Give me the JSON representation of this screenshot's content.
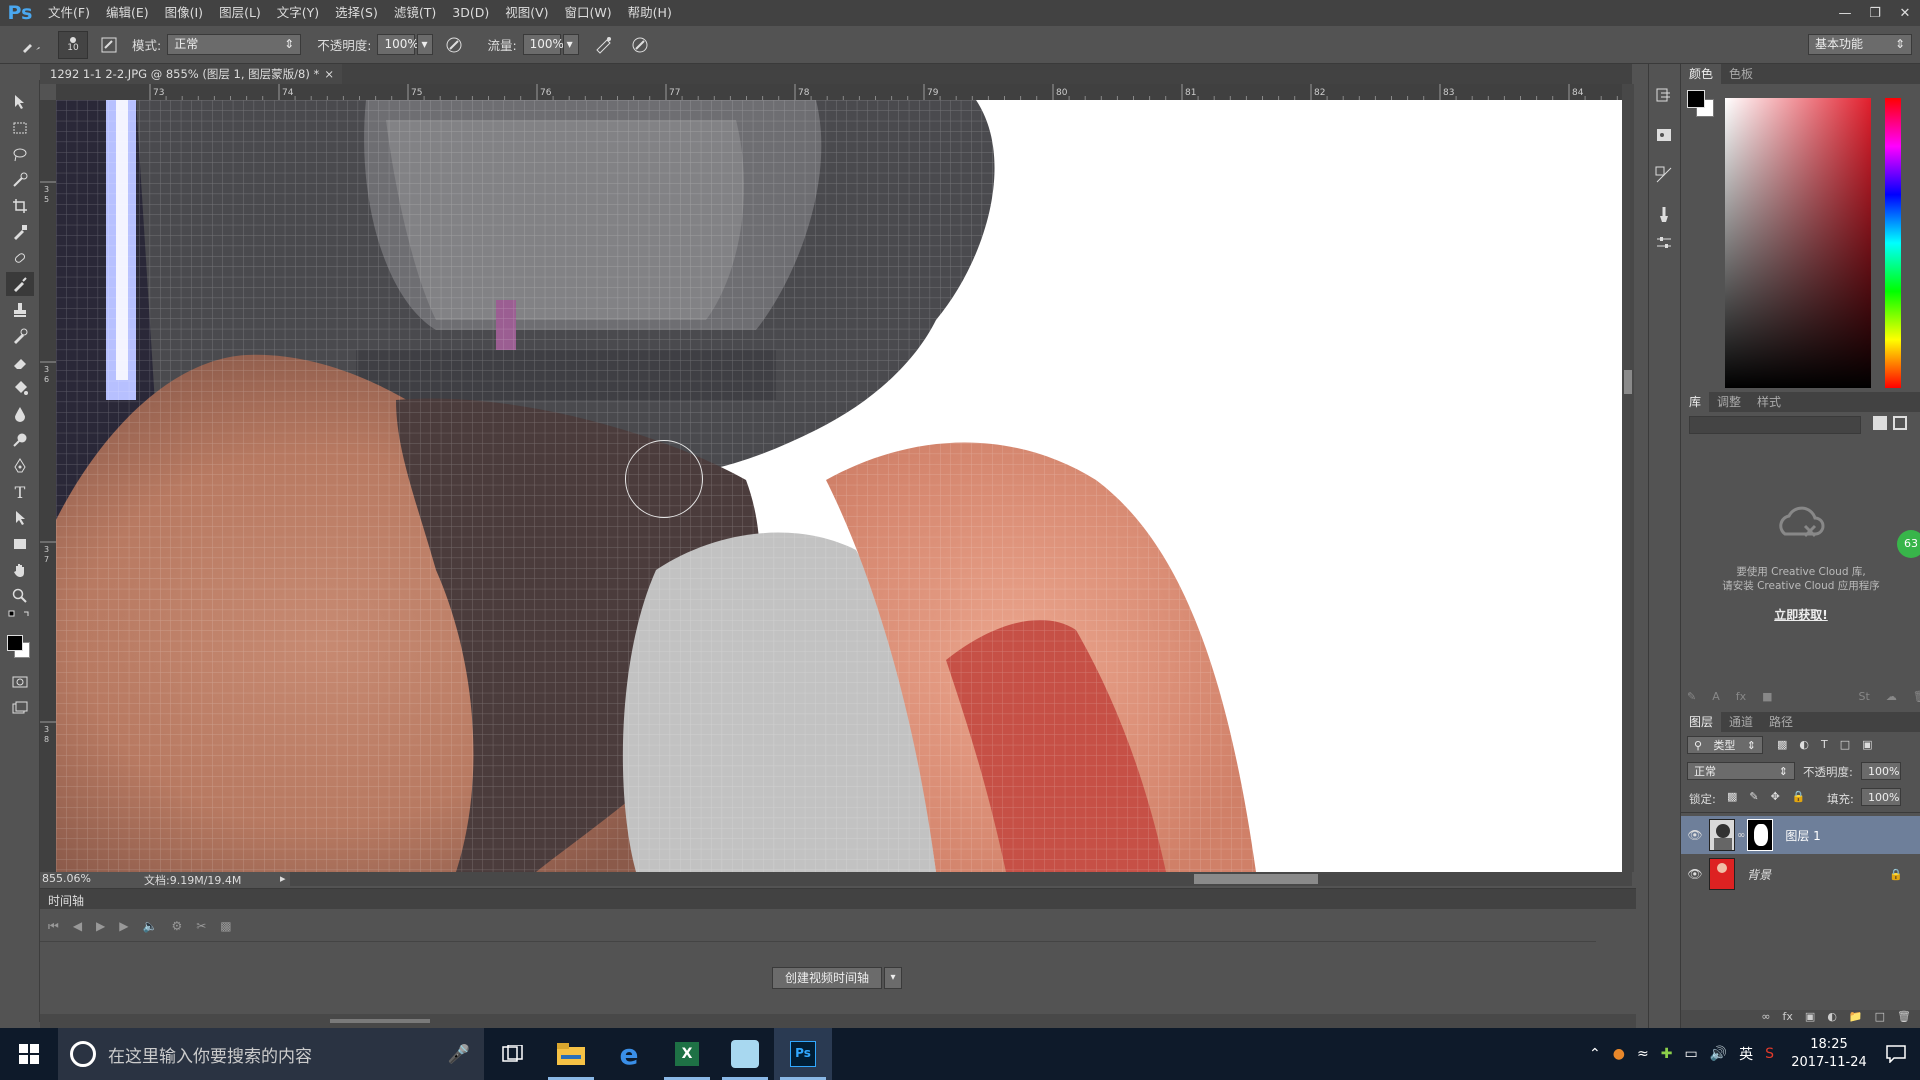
{
  "app": {
    "logo": "Ps"
  },
  "menu": [
    "文件(F)",
    "编辑(E)",
    "图像(I)",
    "图层(L)",
    "文字(Y)",
    "选择(S)",
    "滤镜(T)",
    "3D(D)",
    "视图(V)",
    "窗口(W)",
    "帮助(H)"
  ],
  "options": {
    "brush_size": "10",
    "mode_label": "模式:",
    "mode_value": "正常",
    "opacity_label": "不透明度:",
    "opacity_value": "100%",
    "flow_label": "流量:",
    "flow_value": "100%",
    "workspace": "基本功能"
  },
  "document": {
    "tab_title": "1292 1-1 2-2.JPG @ 855% (图层 1, 图层蒙版/8) *",
    "zoom": "855.06%",
    "doc_info": "文档:9.19M/19.4M"
  },
  "ruler": {
    "h_ticks": [
      "73",
      "74",
      "75",
      "76",
      "77",
      "78",
      "79",
      "80",
      "81",
      "82",
      "83",
      "84"
    ],
    "v_ticks": [
      "3 5",
      "3 6",
      "3 7",
      "3 8"
    ]
  },
  "timeline": {
    "tab": "时间轴",
    "create_button": "创建视频时间轴"
  },
  "color_panel": {
    "tabs": [
      "颜色",
      "色板"
    ]
  },
  "library_panel": {
    "tabs": [
      "库",
      "调整",
      "样式"
    ],
    "message_line1": "要使用 Creative Cloud 库,",
    "message_line2": "请安装 Creative Cloud 应用程序",
    "cta": "立即获取!",
    "badge": "63"
  },
  "layers_panel": {
    "tabs": [
      "图层",
      "通道",
      "路径"
    ],
    "filter": "类型",
    "blend_mode": "正常",
    "opacity_label": "不透明度:",
    "opacity_value": "100%",
    "lock_label": "锁定:",
    "fill_label": "填充:",
    "fill_value": "100%",
    "layers": [
      {
        "name": "图层 1",
        "selected": true
      },
      {
        "name": "背景",
        "selected": false
      }
    ]
  },
  "taskbar": {
    "search_placeholder": "在这里输入你要搜索的内容",
    "ime": "英",
    "time": "18:25",
    "date": "2017-11-24"
  }
}
